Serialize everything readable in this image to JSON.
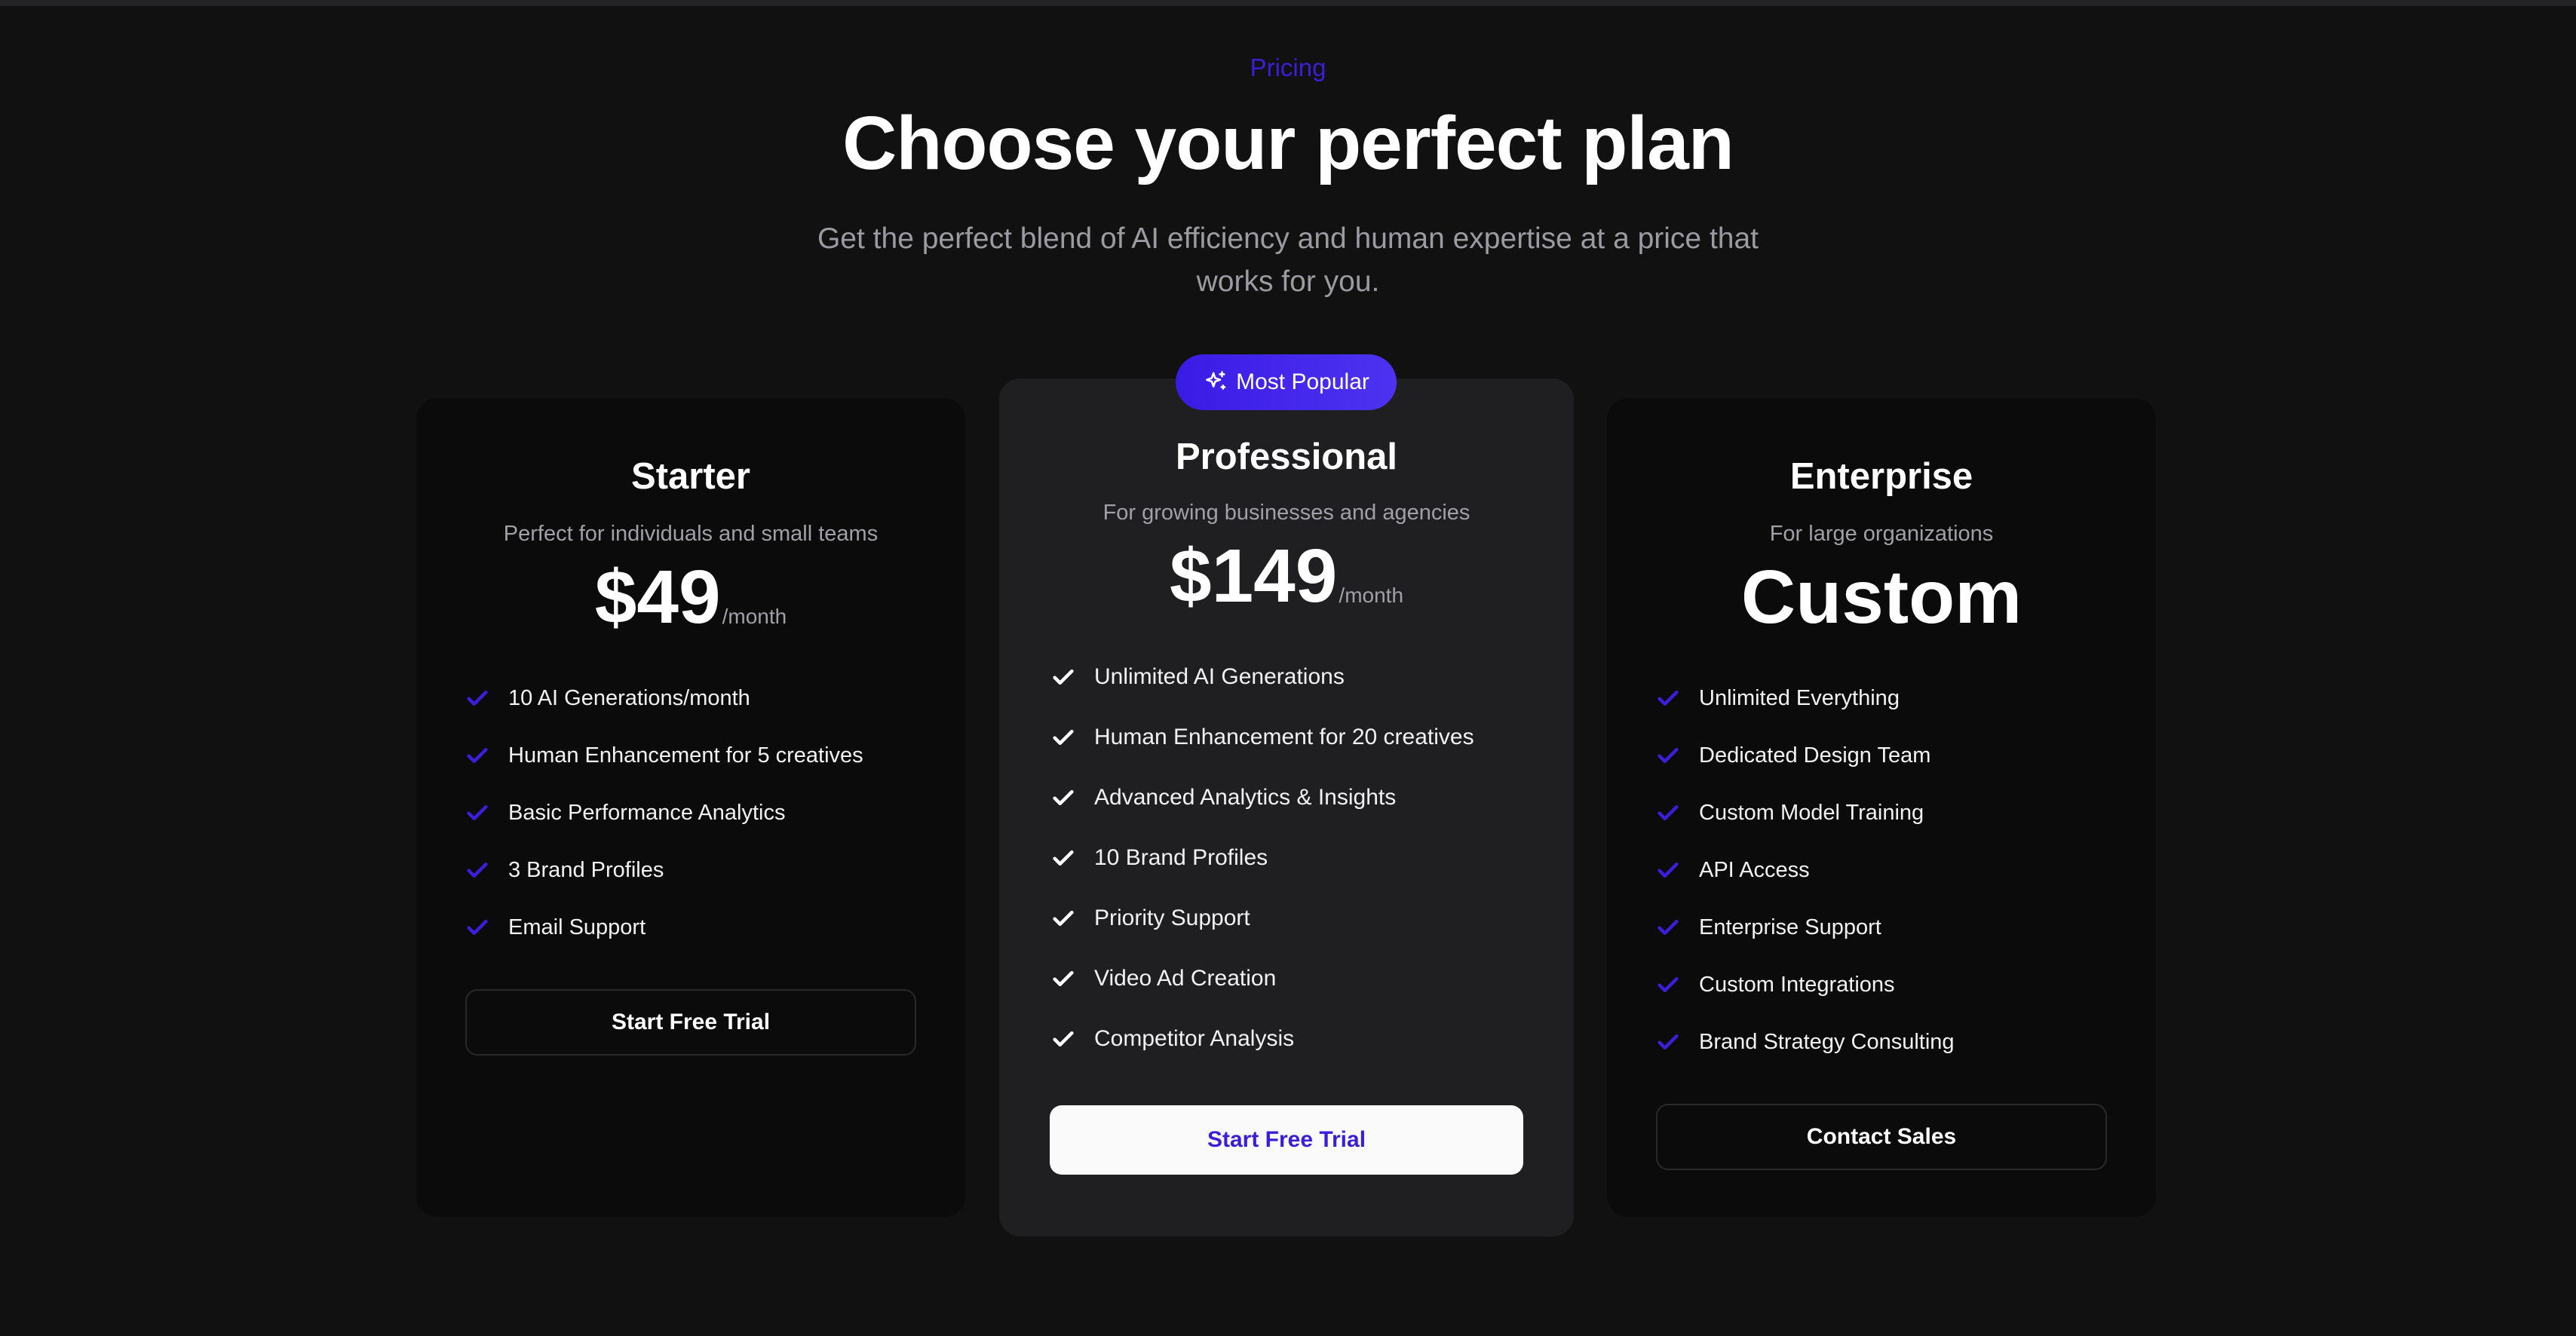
{
  "header": {
    "eyebrow": "Pricing",
    "title": "Choose your perfect plan",
    "subtitle": "Get the perfect blend of AI efficiency and human expertise at a price that works for you."
  },
  "badge": {
    "label": "Most Popular",
    "icon": "sparkle-icon"
  },
  "colors": {
    "background": "#111111",
    "card": "#0b0b0b",
    "featured_card": "#1f1f21",
    "accent": "#3b1ed9",
    "muted_text": "#a0a0a6"
  },
  "plans": [
    {
      "name": "Starter",
      "description": "Perfect for individuals and small teams",
      "price": "$49",
      "period": "/month",
      "features": [
        "10 AI Generations/month",
        "Human Enhancement for 5 creatives",
        "Basic Performance Analytics",
        "3 Brand Profiles",
        "Email Support"
      ],
      "cta": "Start Free Trial"
    },
    {
      "name": "Professional",
      "description": "For growing businesses and agencies",
      "price": "$149",
      "period": "/month",
      "features": [
        "Unlimited AI Generations",
        "Human Enhancement for 20 creatives",
        "Advanced Analytics & Insights",
        "10 Brand Profiles",
        "Priority Support",
        "Video Ad Creation",
        "Competitor Analysis"
      ],
      "cta": "Start Free Trial"
    },
    {
      "name": "Enterprise",
      "description": "For large organizations",
      "price": "Custom",
      "features": [
        "Unlimited Everything",
        "Dedicated Design Team",
        "Custom Model Training",
        "API Access",
        "Enterprise Support",
        "Custom Integrations",
        "Brand Strategy Consulting"
      ],
      "cta": "Contact Sales"
    }
  ]
}
